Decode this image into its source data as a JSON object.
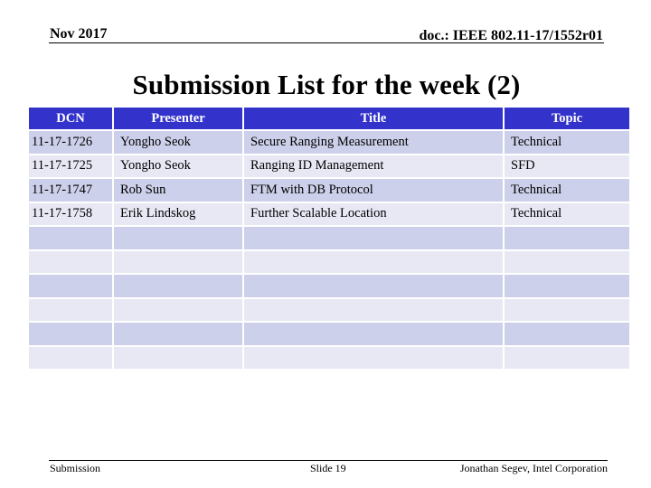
{
  "header": {
    "date": "Nov 2017",
    "doc_id": "doc.: IEEE 802.11-17/1552r01"
  },
  "slide": {
    "title": "Submission List for the week (2)"
  },
  "table": {
    "columns": [
      "DCN",
      "Presenter",
      "Title",
      "Topic"
    ],
    "rows": [
      [
        "11-17-1726",
        "Yongho Seok",
        "Secure Ranging Measurement",
        "Technical"
      ],
      [
        "11-17-1725",
        "Yongho Seok",
        "Ranging ID Management",
        "SFD"
      ],
      [
        "11-17-1747",
        "Rob Sun",
        "FTM with DB Protocol",
        "Technical"
      ],
      [
        "11-17-1758",
        "Erik Lindskog",
        "Further Scalable Location",
        "Technical"
      ],
      [
        "",
        "",
        "",
        ""
      ],
      [
        "",
        "",
        "",
        ""
      ],
      [
        "",
        "",
        "",
        ""
      ],
      [
        "",
        "",
        "",
        ""
      ],
      [
        "",
        "",
        "",
        ""
      ],
      [
        "",
        "",
        "",
        ""
      ]
    ],
    "colors": {
      "header_bg": "#3333cc",
      "header_text": "#ffffff",
      "row_odd": "#cdd0ea",
      "row_even": "#e7e8f4"
    }
  },
  "footer": {
    "left": "Submission",
    "center": "Slide 19",
    "right": "Jonathan Segev, Intel Corporation"
  }
}
